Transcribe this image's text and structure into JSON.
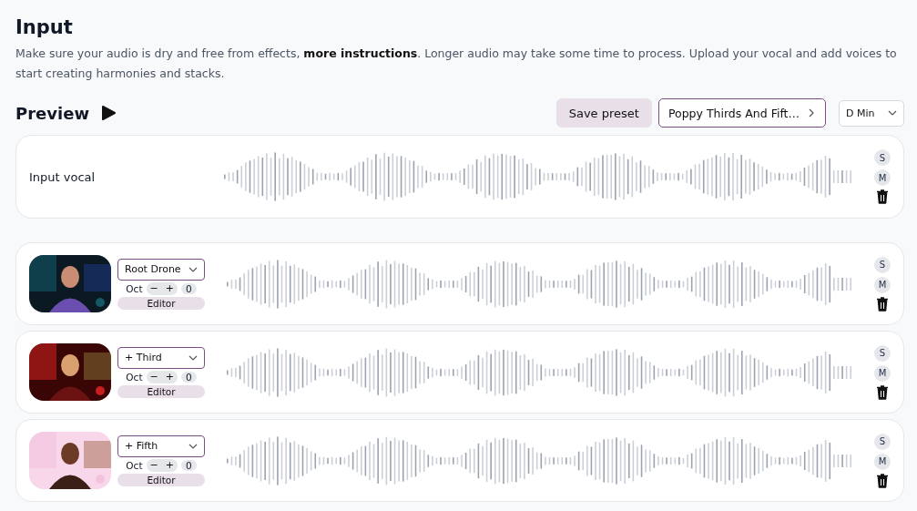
{
  "header": {
    "title": "Input",
    "description_before": "Make sure your audio is dry and free from effects, ",
    "link": "more instructions",
    "description_after": ". Longer audio may take some time to process. Upload your vocal and add voices to start creating harmonies and stacks."
  },
  "preview": {
    "title": "Preview",
    "save_button": "Save preset",
    "preset": "Poppy Thirds And Fift…",
    "key": "D Min"
  },
  "input_track": {
    "label": "Input vocal",
    "solo": "S",
    "mute": "M"
  },
  "tracks": [
    {
      "kind": "picture",
      "voice": "Root Drone",
      "oct_label": "Oct",
      "minus": "−",
      "plus": "+",
      "octave": "0",
      "editor": "Editor",
      "solo": "S",
      "mute": "M"
    },
    {
      "kind": "picture",
      "voice": "+ Third",
      "oct_label": "Oct",
      "minus": "−",
      "plus": "+",
      "octave": "0",
      "editor": "Editor",
      "solo": "S",
      "mute": "M"
    },
    {
      "kind": "picture",
      "voice": "+ Fifth",
      "oct_label": "Oct",
      "minus": "−",
      "plus": "+",
      "octave": "0",
      "editor": "Editor",
      "solo": "S",
      "mute": "M"
    }
  ]
}
